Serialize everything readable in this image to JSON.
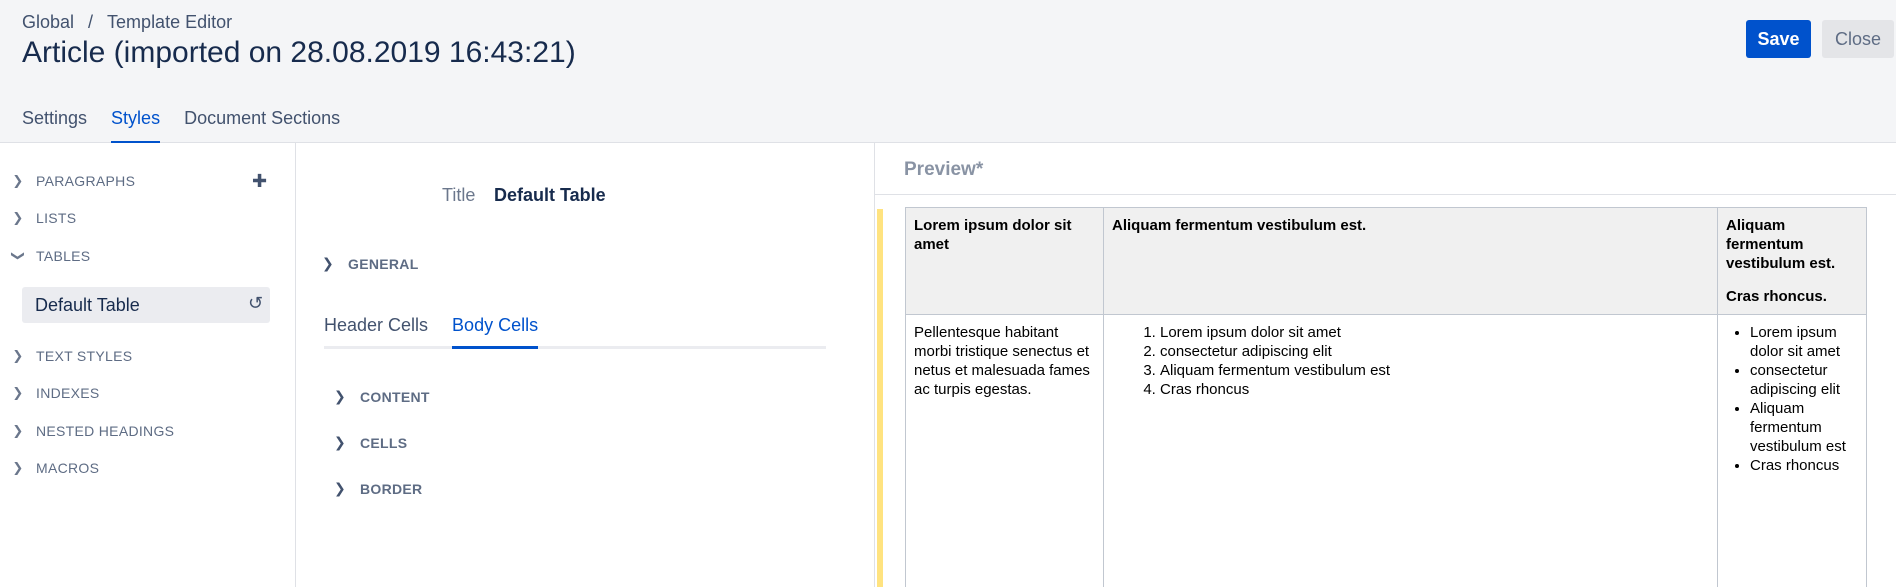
{
  "breadcrumb": {
    "items": [
      "Global",
      "Template Editor"
    ],
    "separator": "/"
  },
  "page": {
    "title": "Article (imported on 28.08.2019 16:43:21)"
  },
  "actions": {
    "save_label": "Save",
    "close_label": "Close"
  },
  "main_tabs": [
    {
      "label": "Settings",
      "active": false
    },
    {
      "label": "Styles",
      "active": true
    },
    {
      "label": "Document Sections",
      "active": false
    }
  ],
  "sidebar": {
    "items": [
      {
        "label": "PARAGRAPHS",
        "icon": "chevron-right-icon",
        "expanded": false
      },
      {
        "label": "LISTS",
        "icon": "chevron-right-icon",
        "expanded": false
      },
      {
        "label": "TABLES",
        "icon": "chevron-down-icon",
        "expanded": true
      },
      {
        "label": "TEXT STYLES",
        "icon": "chevron-right-icon",
        "expanded": false
      },
      {
        "label": "INDEXES",
        "icon": "chevron-right-icon",
        "expanded": false
      },
      {
        "label": "NESTED HEADINGS",
        "icon": "chevron-right-icon",
        "expanded": false
      },
      {
        "label": "MACROS",
        "icon": "chevron-right-icon",
        "expanded": false
      }
    ],
    "selected_style": "Default Table",
    "add_icon": "plus-icon",
    "reset_icon": "reset-icon"
  },
  "editor": {
    "title_label": "Title",
    "title_value": "Default Table",
    "general_label": "GENERAL",
    "sub_tabs": [
      {
        "label": "Header Cells",
        "active": false
      },
      {
        "label": "Body Cells",
        "active": true
      }
    ],
    "sections": [
      "CONTENT",
      "CELLS",
      "BORDER"
    ]
  },
  "preview": {
    "title": "Preview*",
    "accent_color": "#ffe380",
    "headers": [
      {
        "text": "Lorem ipsum dolor sit amet"
      },
      {
        "text": "Aliquam fermentum vestibulum est."
      },
      {
        "text": "Aliquam fermentum vestibulum est.",
        "sub": "Cras rhoncus."
      }
    ],
    "body": {
      "cell1": "Pellentesque habitant morbi tristique senectus et netus et malesuada fames ac turpis egestas.",
      "ordered_list": [
        "Lorem ipsum dolor sit amet",
        "consectetur adipiscing elit",
        "Aliquam fermentum vestibulum est",
        "Cras rhoncus"
      ],
      "bullet_list": [
        "Lorem ipsum dolor sit amet",
        "consectetur adipiscing elit",
        "Aliquam fermentum vestibulum est",
        "Cras rhoncus"
      ]
    }
  },
  "colors": {
    "primary": "#0052cc",
    "text": "#172b4d",
    "muted": "#5e6c84",
    "header_bg": "#f4f5f7"
  }
}
